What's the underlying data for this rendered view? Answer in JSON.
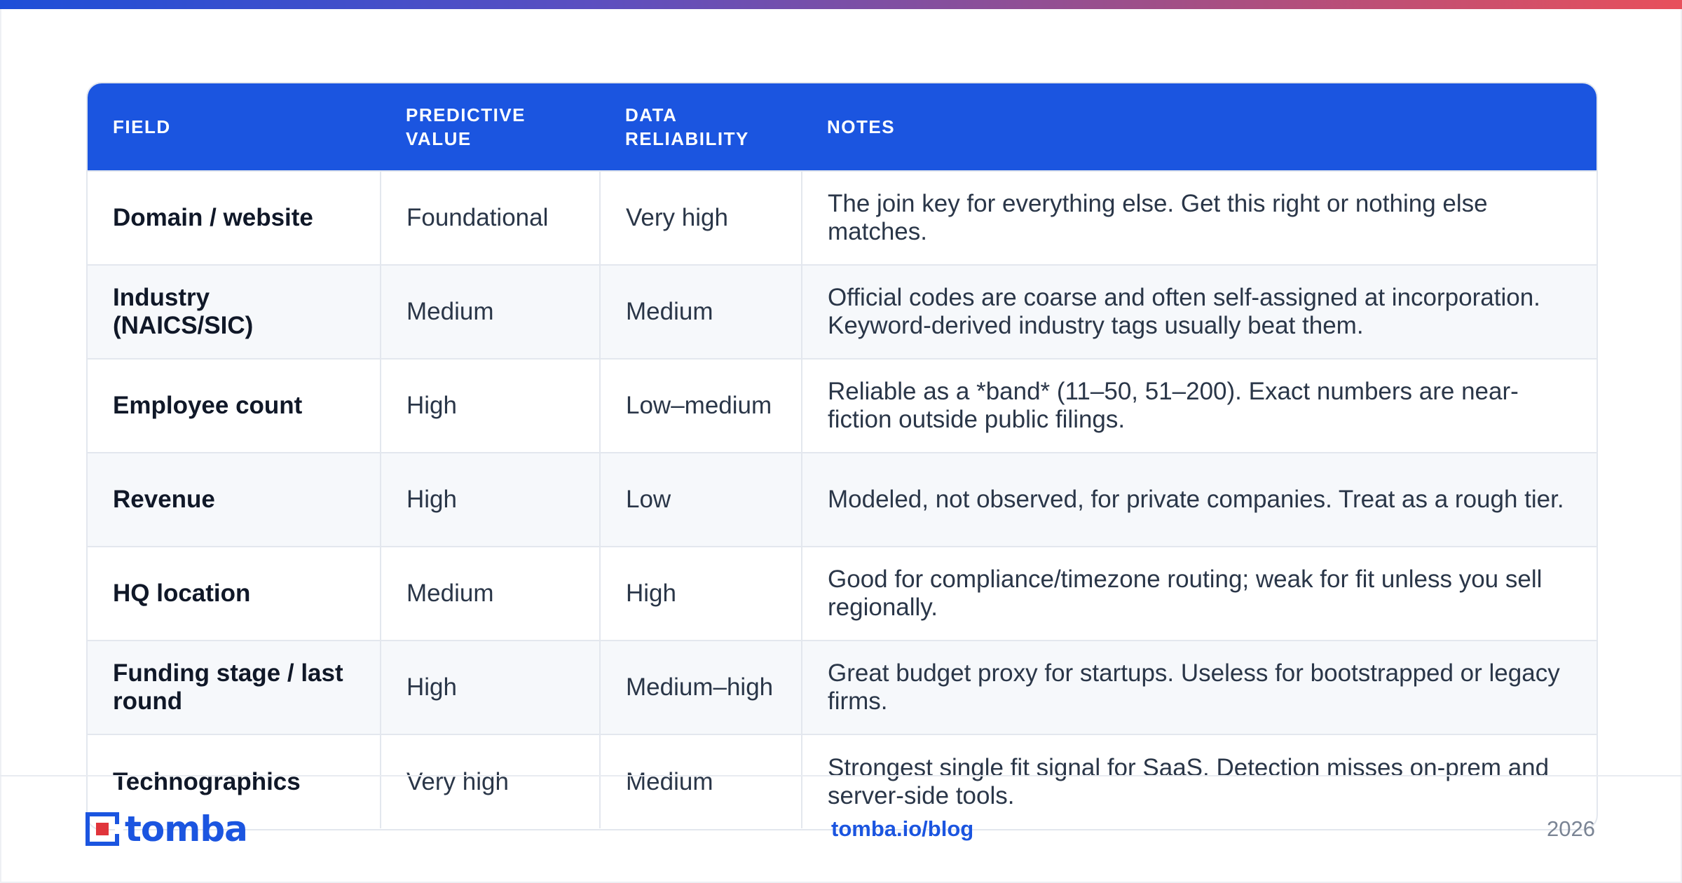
{
  "header": {
    "field": "FIELD",
    "predictive_value": "PREDICTIVE VALUE",
    "data_reliability": "DATA RELIABILITY",
    "notes": "NOTES"
  },
  "rows": [
    {
      "field": "Domain / website",
      "predictive": "Foundational",
      "reliability": "Very high",
      "notes": "The join key for everything else. Get this right or nothing else matches."
    },
    {
      "field": "Industry (NAICS/SIC)",
      "predictive": "Medium",
      "reliability": "Medium",
      "notes": "Official codes are coarse and often self-assigned at incorporation. Keyword-derived industry tags usually beat them."
    },
    {
      "field": "Employee count",
      "predictive": "High",
      "reliability": "Low–medium",
      "notes": "Reliable as a *band* (11–50, 51–200). Exact numbers are near-fiction outside public filings."
    },
    {
      "field": "Revenue",
      "predictive": "High",
      "reliability": "Low",
      "notes": "Modeled, not observed, for private companies. Treat as a rough tier."
    },
    {
      "field": "HQ location",
      "predictive": "Medium",
      "reliability": "High",
      "notes": "Good for compliance/timezone routing; weak for fit unless you sell regionally."
    },
    {
      "field": "Funding stage / last round",
      "predictive": "High",
      "reliability": "Medium–high",
      "notes": "Great budget proxy for startups. Useless for bootstrapped or legacy firms."
    },
    {
      "field": "Technographics",
      "predictive": "Very high",
      "reliability": "Medium",
      "notes": "Strongest single fit signal for SaaS. Detection misses on-prem and server-side tools."
    }
  ],
  "footer": {
    "logo_text": "tomba",
    "link": "tomba.io/blog",
    "year": "2026"
  },
  "colors": {
    "accent": "#1b55e0",
    "logo_red": "#e0353b"
  }
}
